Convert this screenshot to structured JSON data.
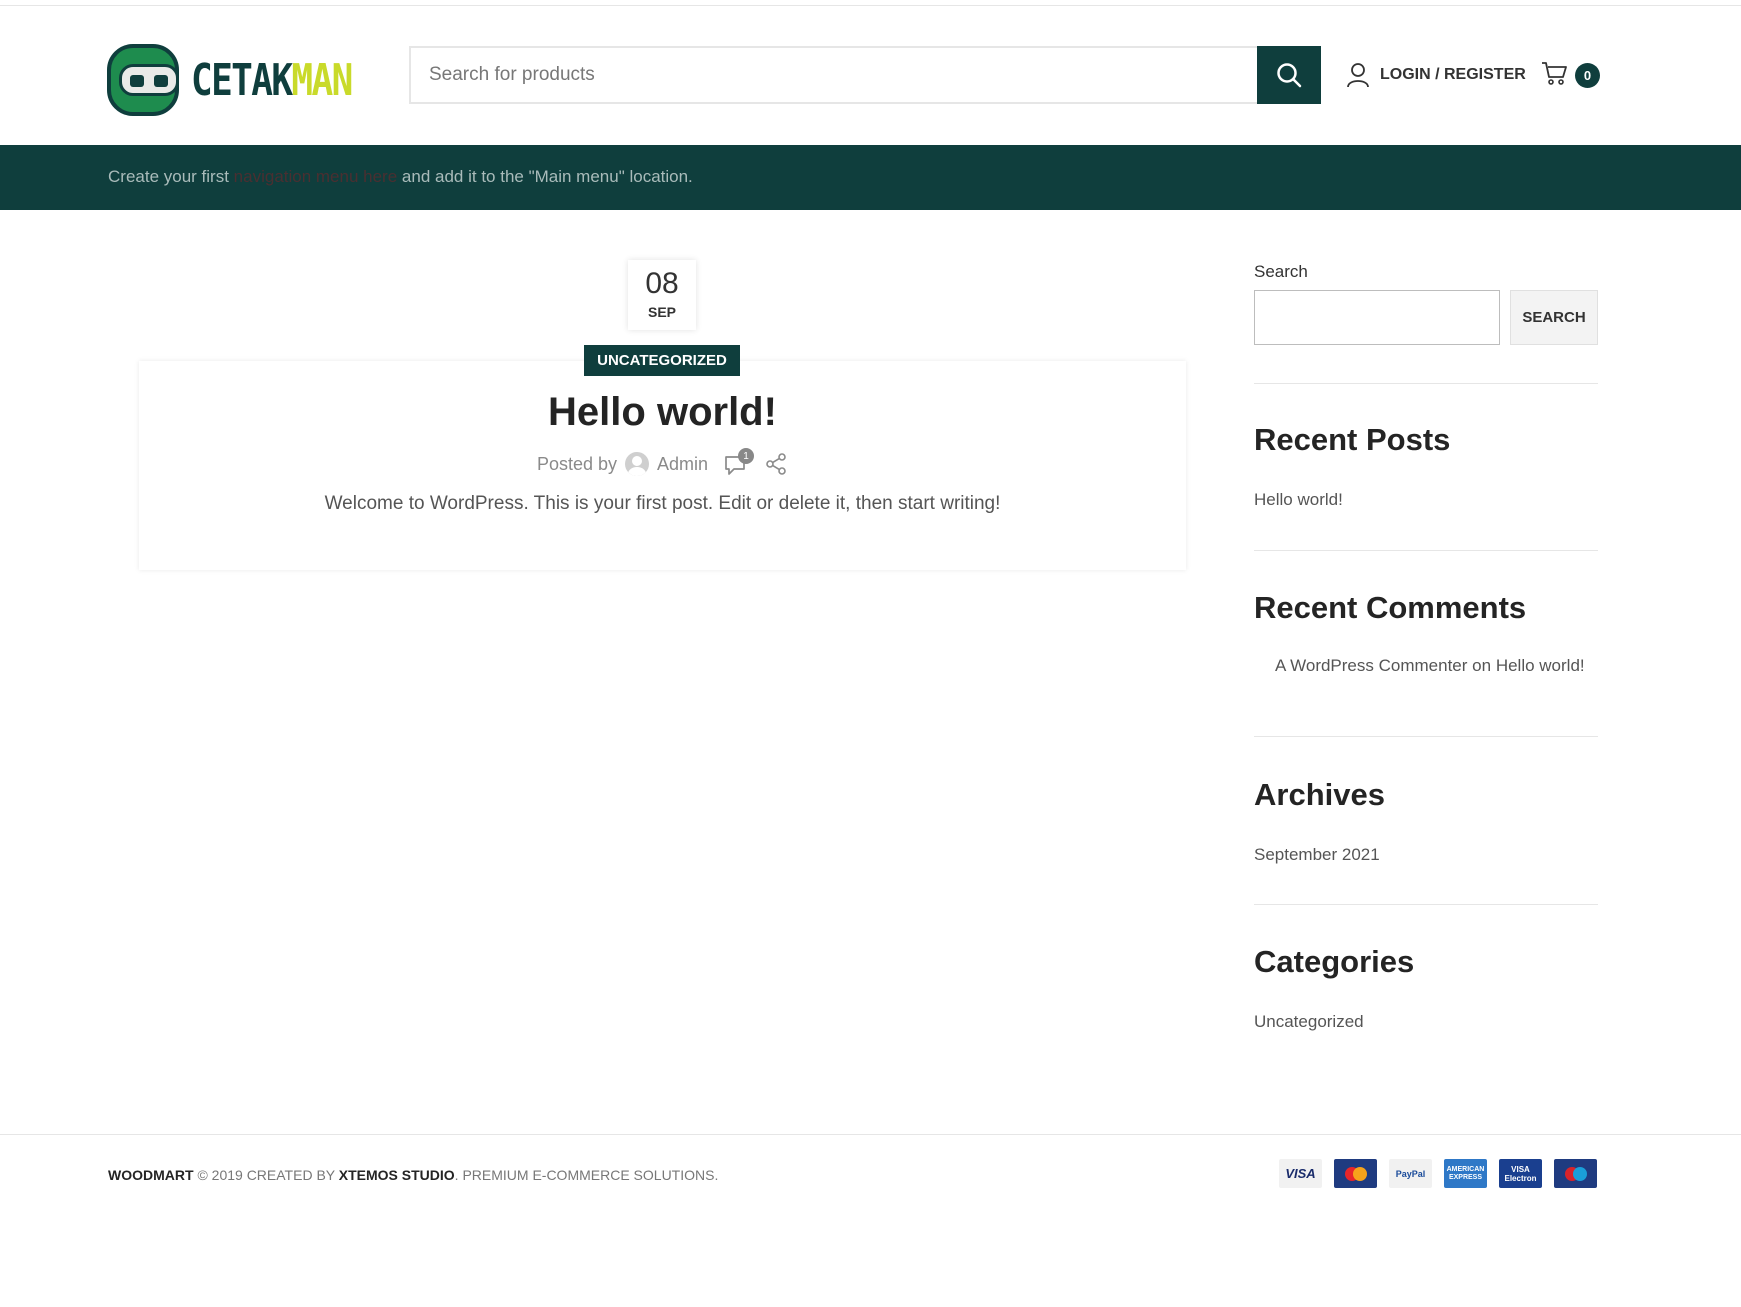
{
  "header": {
    "logo_part1": "CETAK",
    "logo_part2": "MAN",
    "search_placeholder": "Search for products",
    "login_label": "Login / Register",
    "cart_count": "0"
  },
  "navbar": {
    "message_before": "Create your first",
    "message_link": "navigation menu here",
    "message_after": "and add it to the \"Main menu\" location."
  },
  "post": {
    "day": "08",
    "month": "SEP",
    "category": "Uncategorized",
    "title": "Hello world!",
    "posted_by_label": "Posted by",
    "author": "Admin",
    "comment_count": "1",
    "excerpt": "Welcome to WordPress. This is your first post. Edit or delete it, then start writing!"
  },
  "sidebar": {
    "search_label": "Search",
    "search_button": "Search",
    "recent_posts_title": "Recent Posts",
    "recent_posts": [
      "Hello world!"
    ],
    "recent_comments_title": "Recent Comments",
    "recent_comment": {
      "author": "A WordPress Commenter",
      "on": "on",
      "post": "Hello world!"
    },
    "archives_title": "Archives",
    "archives": [
      "September 2021"
    ],
    "categories_title": "Categories",
    "categories": [
      "Uncategorized"
    ]
  },
  "footer": {
    "brand": "Woodmart",
    "copyright_symbol": "©",
    "year_text": "2019 Created by",
    "studio": "Xtemos Studio",
    "tagline": ". Premium e-commerce solutions.",
    "payment_methods": [
      {
        "icon": "visa-icon",
        "label": "VISA"
      },
      {
        "icon": "mastercard-icon",
        "label": ""
      },
      {
        "icon": "paypal-icon",
        "label": "PayPal"
      },
      {
        "icon": "amex-icon",
        "label": "AMERICAN EXPRESS"
      },
      {
        "icon": "visa-electron-icon",
        "label": "VISA Electron"
      },
      {
        "icon": "maestro-icon",
        "label": ""
      }
    ]
  },
  "colors": {
    "brand_dark": "#0f3e3d",
    "brand_lime": "#c9da2a",
    "brand_green": "#1e8c4e"
  }
}
